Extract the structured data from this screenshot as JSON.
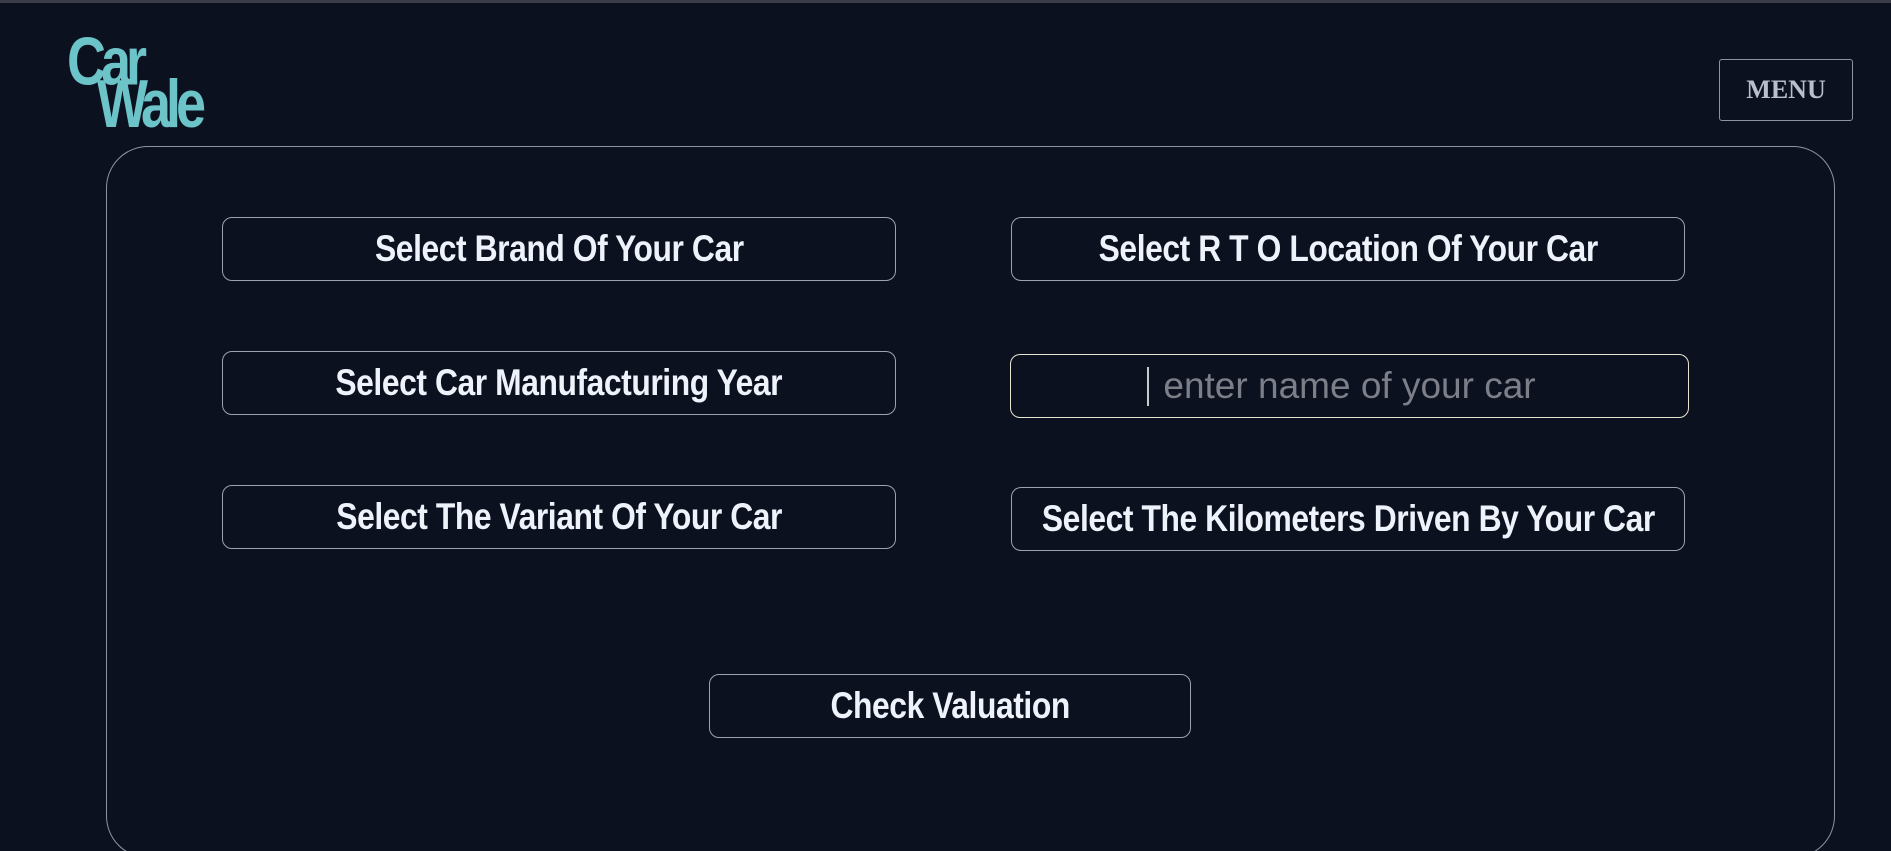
{
  "logo": {
    "line1": "Car",
    "line2": "Wale"
  },
  "header": {
    "menu_label": "MENU"
  },
  "form": {
    "brand_label": "Select Brand Of Your Car",
    "rto_label": "Select R T O Location Of Your Car",
    "year_label": "Select Car Manufacturing Year",
    "car_name_placeholder": "enter name of your car",
    "car_name_value": "",
    "variant_label": "Select The Variant Of Your Car",
    "kilometers_label": "Select The Kilometers Driven By Your Car",
    "submit_label": "Check Valuation"
  },
  "colors": {
    "background": "#0c1120",
    "logo": "#6cc3c8",
    "border": "#9ba2b2",
    "text": "#eef2fa",
    "focused_border": "#e8e6d2"
  }
}
